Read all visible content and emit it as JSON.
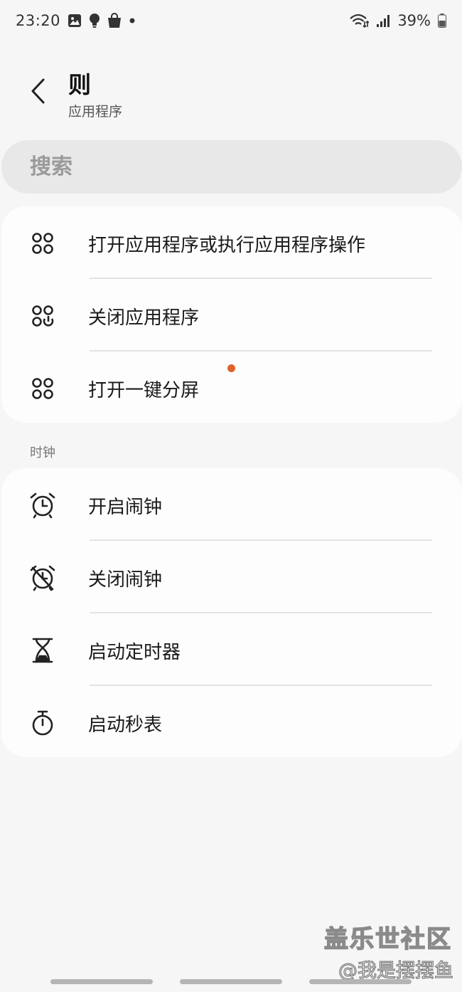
{
  "status_bar": {
    "time": "23:20",
    "left_icons": [
      "gallery-icon",
      "bulb-icon",
      "shopping-bag-icon",
      "dot-icon"
    ],
    "right_icons": [
      "wifi-icon",
      "signal-icon",
      "battery-icon"
    ],
    "battery": "39%"
  },
  "header": {
    "title": "则",
    "subtitle": "应用程序"
  },
  "search": {
    "placeholder": "搜索"
  },
  "apps": {
    "items": [
      {
        "label": "打开应用程序或执行应用程序操作",
        "icon": "apps-grid-icon"
      },
      {
        "label": "关闭应用程序",
        "icon": "apps-close-icon"
      },
      {
        "label": "打开一键分屏",
        "icon": "apps-grid-icon",
        "badge_color": "#e0622a"
      }
    ]
  },
  "clock": {
    "section_label": "时钟",
    "items": [
      {
        "label": "开启闹钟",
        "icon": "alarm-icon"
      },
      {
        "label": "关闭闹钟",
        "icon": "alarm-off-icon"
      },
      {
        "label": "启动定时器",
        "icon": "hourglass-icon"
      },
      {
        "label": "启动秒表",
        "icon": "stopwatch-icon"
      }
    ]
  },
  "watermark": {
    "line1": "盖乐世社区",
    "line2": "@我是摆摆鱼"
  }
}
